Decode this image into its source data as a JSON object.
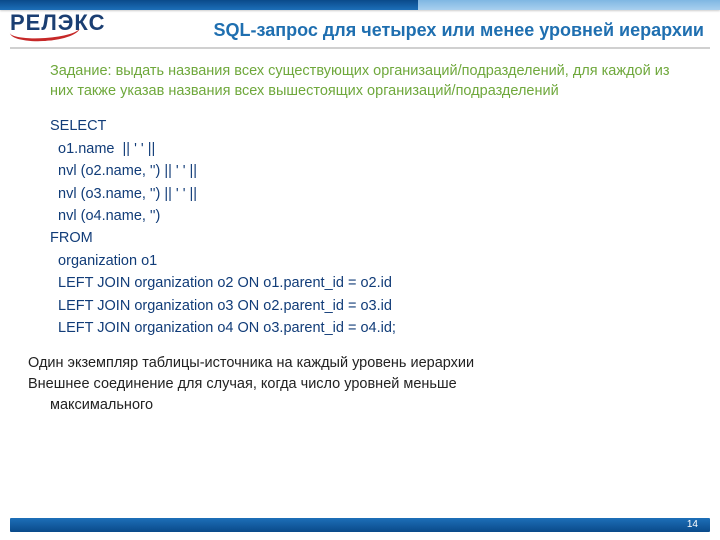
{
  "logo_text": "РЕЛЭКС",
  "title": "SQL-запрос для четырех или менее уровней иерархии",
  "task": "Задание: выдать названия всех существующих организаций/подразделений, для каждой из них также указав названия всех вышестоящих организаций/подразделений",
  "sql": "SELECT\n  o1.name  || ' ' ||\n  nvl (o2.name, '') || ' ' ||\n  nvl (o3.name, '') || ' ' ||\n  nvl (o4.name, '')\nFROM\n  organization o1\n  LEFT JOIN organization o2 ON o1.parent_id = o2.id\n  LEFT JOIN organization o3 ON o2.parent_id = o3.id\n  LEFT JOIN organization o4 ON o3.parent_id = o4.id;",
  "note1": "Один экземпляр таблицы-источника на каждый уровень иерархии",
  "note2a": "Внешнее соединение для случая, когда число уровней меньше",
  "note2b": "максимального",
  "page": "14"
}
